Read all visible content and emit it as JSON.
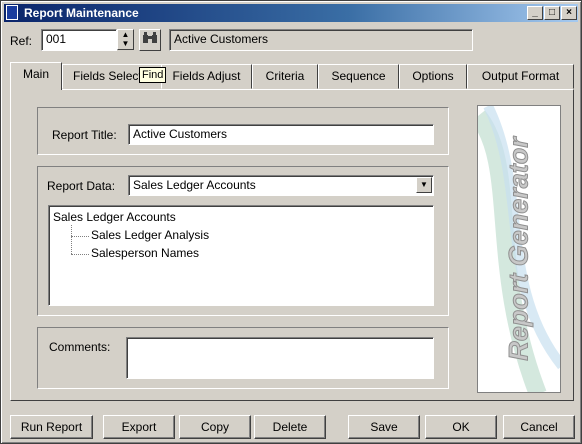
{
  "window": {
    "title": "Report Maintenance",
    "minimize": "_",
    "maximize": "□",
    "close": "×"
  },
  "header": {
    "ref_label": "Ref:",
    "ref_value": "001",
    "ref_description": "Active Customers",
    "find_tooltip": "Find"
  },
  "tabs": [
    {
      "label": "Main",
      "active": true
    },
    {
      "label": "Fields Select",
      "active": false
    },
    {
      "label": "Fields Adjust",
      "active": false
    },
    {
      "label": "Criteria",
      "active": false
    },
    {
      "label": "Sequence",
      "active": false
    },
    {
      "label": "Options",
      "active": false
    },
    {
      "label": "Output Format",
      "active": false
    }
  ],
  "main": {
    "report_title_label": "Report Title:",
    "report_title_value": "Active Customers",
    "report_data_label": "Report Data:",
    "report_data_value": "Sales Ledger Accounts",
    "tree": {
      "root": "Sales Ledger Accounts",
      "children": [
        "Sales Ledger Analysis",
        "Salesperson Names"
      ]
    },
    "comments_label": "Comments:",
    "comments_value": ""
  },
  "graphic": {
    "watermark": "Report Generator"
  },
  "buttons": {
    "run_report": "Run Report",
    "export": "Export",
    "copy": "Copy",
    "delete": "Delete",
    "save": "Save",
    "ok": "OK",
    "cancel": "Cancel"
  },
  "icons": {
    "app": "report-app-icon",
    "find": "binoculars-icon"
  }
}
